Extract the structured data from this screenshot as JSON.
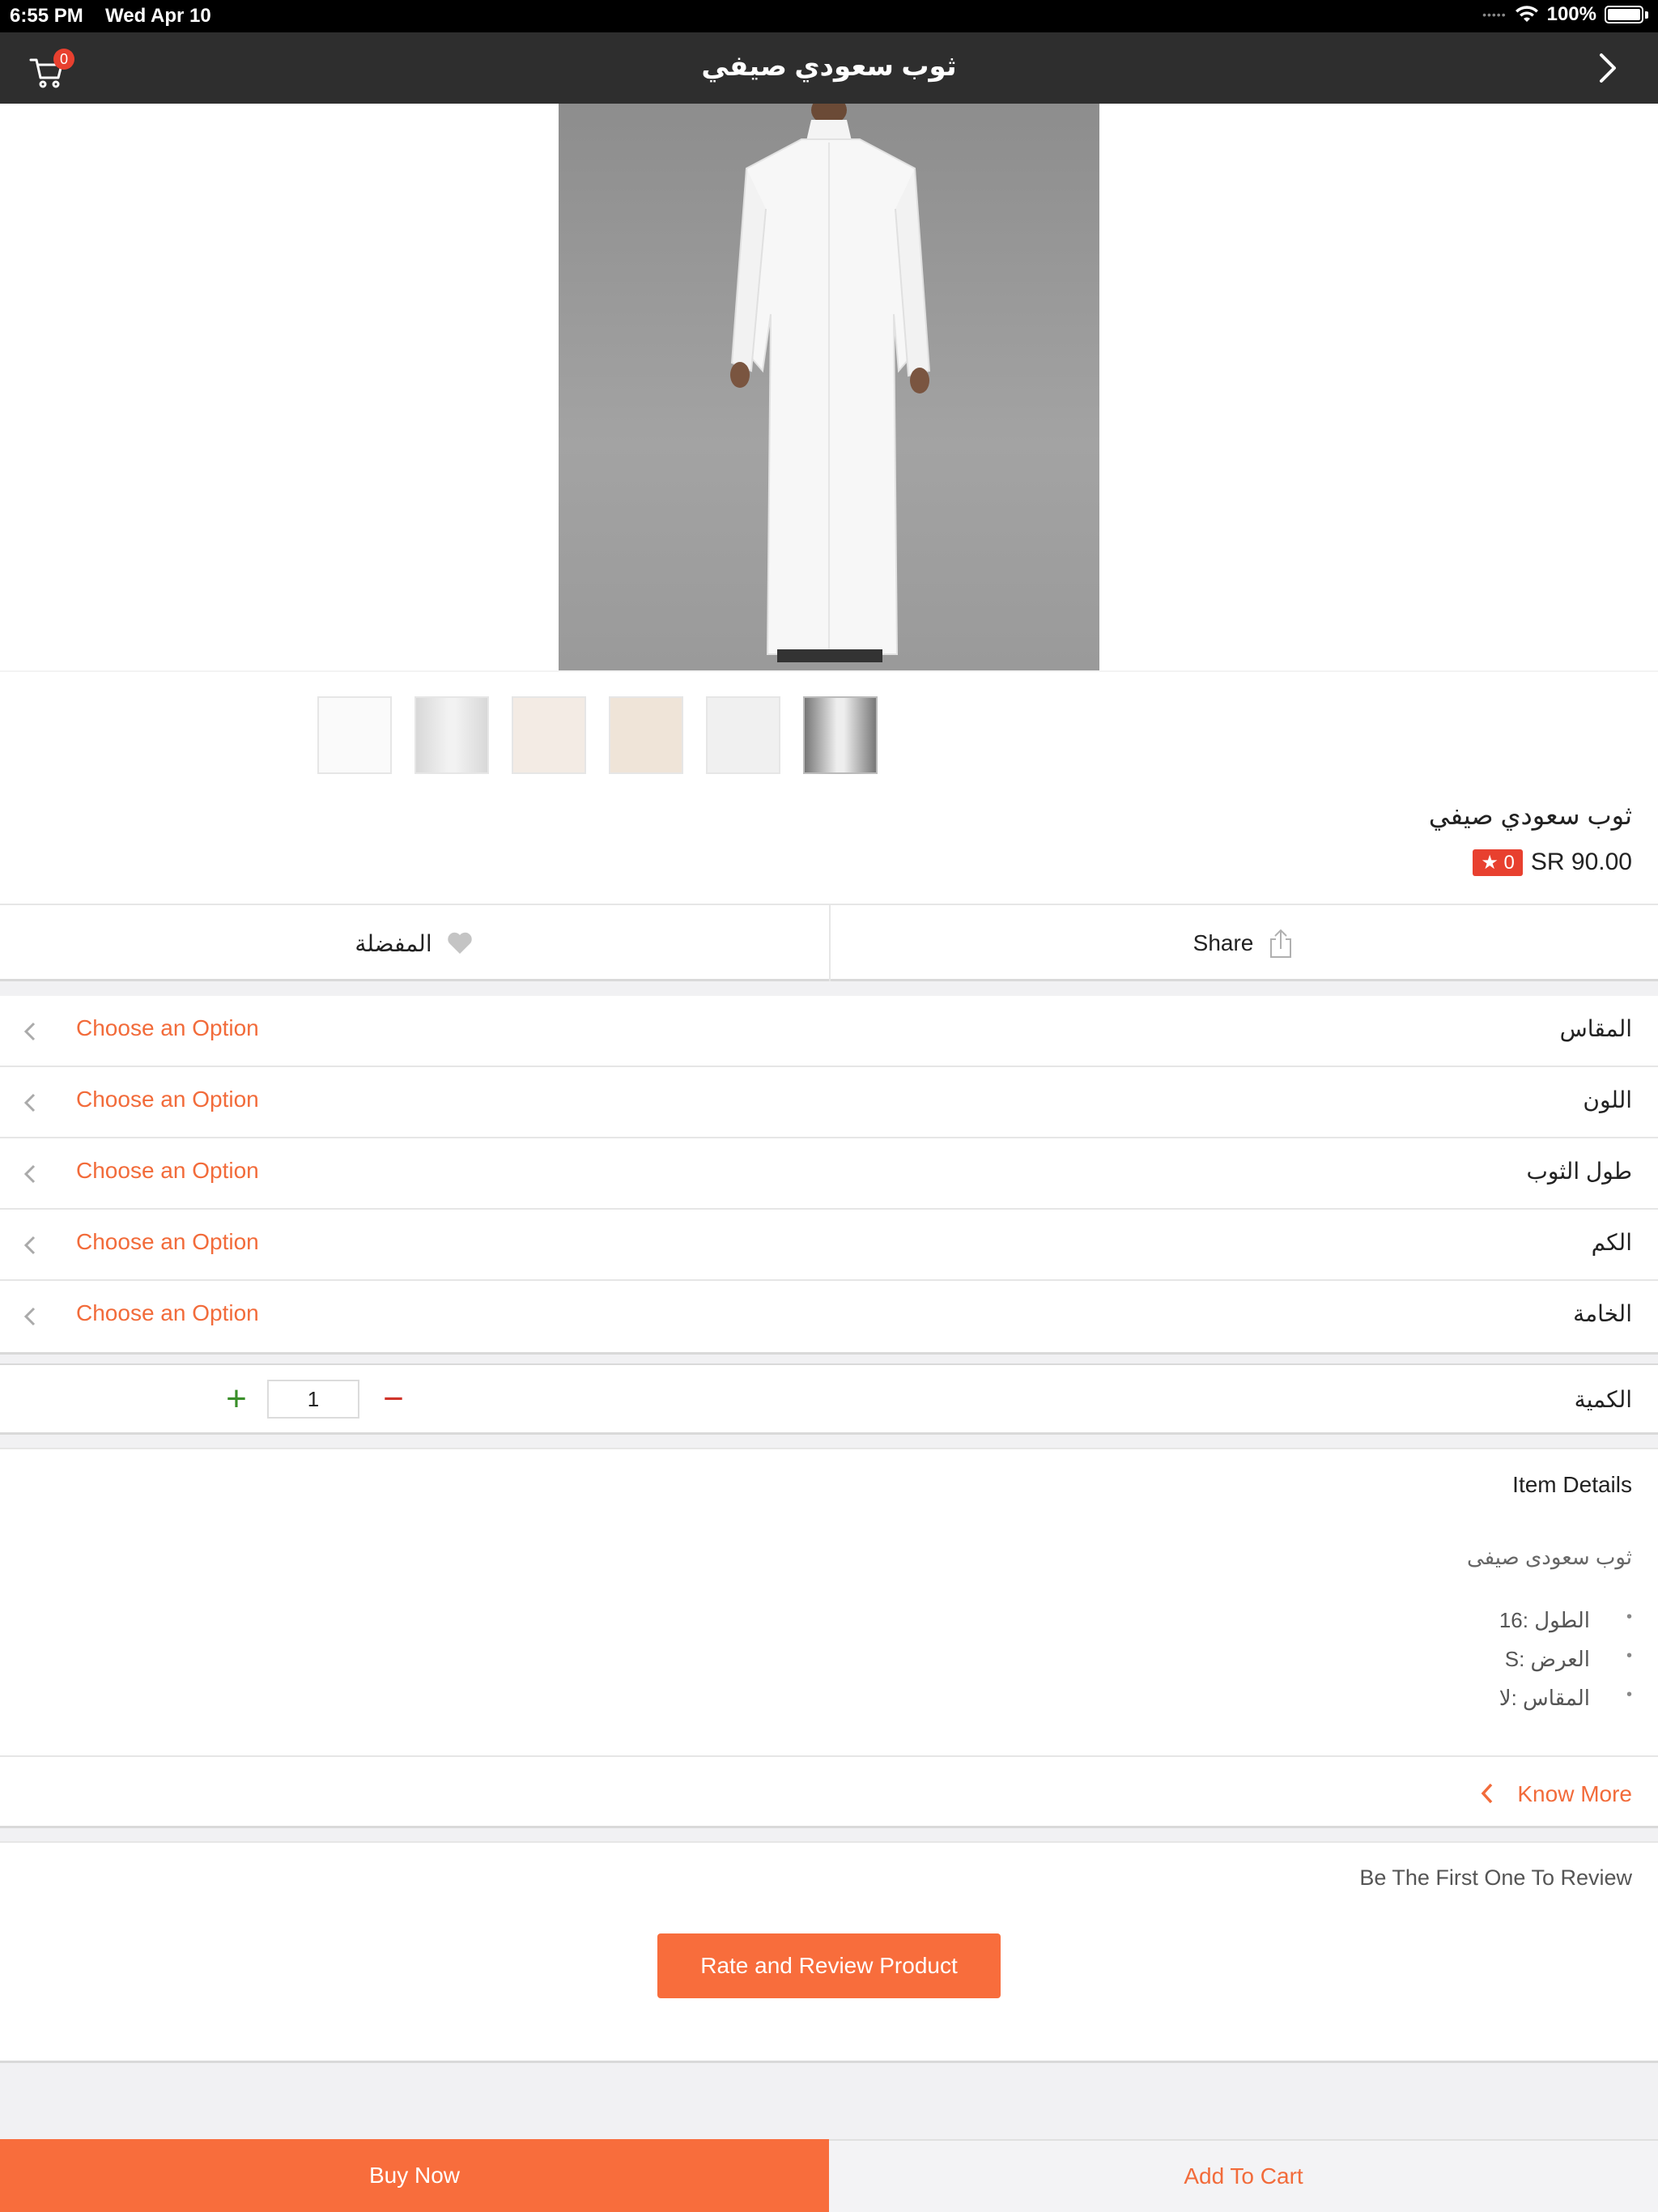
{
  "status_bar": {
    "time": "6:55 PM",
    "date": "Wed Apr 10",
    "battery": "100%"
  },
  "nav": {
    "title": "ثوب سعودي صيفي",
    "cart_count": "0",
    "cart_icon": "cart-icon",
    "back_icon": "chevron-right-icon"
  },
  "product": {
    "name": "ثوب سعودي صيفي",
    "price": "SR 90.00",
    "rating": "★ 0",
    "thumbnails": [
      "thumb-1",
      "thumb-2",
      "thumb-3",
      "thumb-4",
      "thumb-5",
      "thumb-6"
    ],
    "selected_thumbnail_index": 5
  },
  "actions": {
    "favorite_label": "المفضلة",
    "share_label": "Share"
  },
  "options": [
    {
      "label": "المقاس",
      "value": "Choose an Option"
    },
    {
      "label": "اللون",
      "value": "Choose an Option"
    },
    {
      "label": "طول الثوب",
      "value": "Choose an Option"
    },
    {
      "label": "الكم",
      "value": "Choose an Option"
    },
    {
      "label": "الخامة",
      "value": "Choose an Option"
    }
  ],
  "quantity": {
    "label": "الكمية",
    "value": "1",
    "plus": "+",
    "minus": "−"
  },
  "details": {
    "title": "Item Details",
    "description": "ثوب سعودى صيفى",
    "specs": [
      "الطول :16",
      "العرض :S",
      "المقاس :لا"
    ]
  },
  "know_more": "Know More",
  "review": {
    "note": "Be The First One To Review",
    "button": "Rate and Review Product"
  },
  "bottom": {
    "buy_now": "Buy Now",
    "add_to_cart": "Add To Cart"
  },
  "colors": {
    "accent": "#f86d3c",
    "nav_bg": "#2e2e2e",
    "badge": "#e8402f",
    "plus": "#3a8f2a",
    "minus": "#d0342a"
  }
}
